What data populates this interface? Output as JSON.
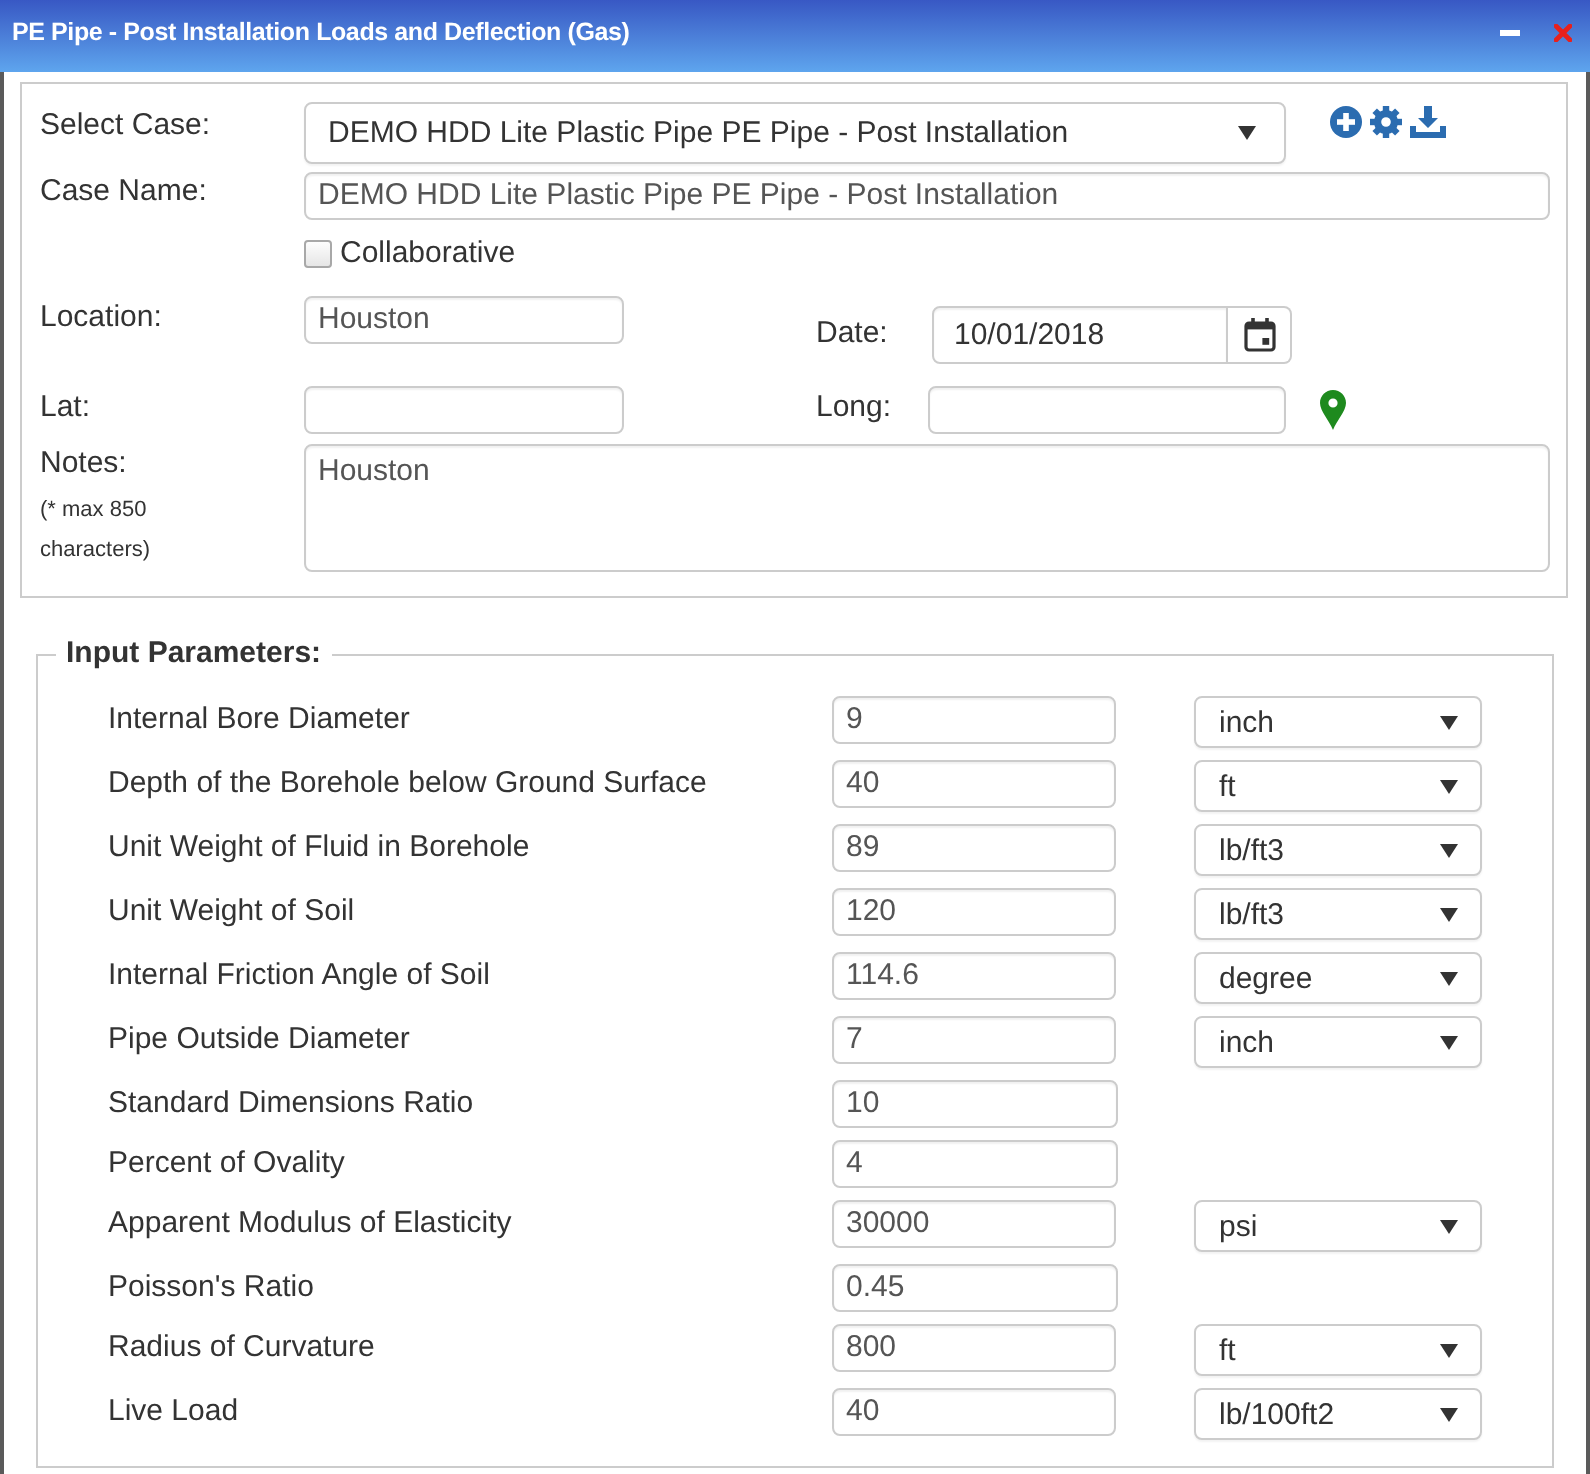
{
  "window": {
    "title": "PE Pipe - Post Installation Loads and Deflection (Gas)"
  },
  "case": {
    "select_case": {
      "label": "Select Case:",
      "value": "DEMO HDD Lite Plastic Pipe PE Pipe - Post Installation"
    },
    "case_name": {
      "label": "Case Name:",
      "value": "DEMO HDD Lite Plastic Pipe PE Pipe - Post Installation"
    },
    "collaborative": {
      "label": "Collaborative",
      "checked": false
    },
    "location": {
      "label": "Location:",
      "value": "Houston"
    },
    "date": {
      "label": "Date:",
      "value": "10/01/2018"
    },
    "lat": {
      "label": "Lat:"
    },
    "long": {
      "label": "Long:"
    },
    "notes": {
      "label": "Notes:",
      "hint": "(* max 850 characters)",
      "value": "Houston"
    }
  },
  "input_parameters": {
    "title": "Input Parameters:",
    "rows": [
      {
        "label": "Internal Bore Diameter",
        "value": "9",
        "unit": "inch"
      },
      {
        "label": "Depth of the Borehole below Ground Surface",
        "value": "40",
        "unit": "ft"
      },
      {
        "label": "Unit Weight of Fluid in Borehole",
        "value": "89",
        "unit": "lb/ft3"
      },
      {
        "label": "Unit Weight of Soil",
        "value": "120",
        "unit": "lb/ft3"
      },
      {
        "label": "Internal Friction Angle of Soil",
        "value": "114.6",
        "unit": "degree"
      },
      {
        "label": "Pipe Outside Diameter",
        "value": "7",
        "unit": "inch"
      },
      {
        "label": "Standard Dimensions Ratio",
        "value": "10"
      },
      {
        "label": "Percent of Ovality",
        "value": "4"
      },
      {
        "label": "Apparent Modulus of Elasticity",
        "value": "30000",
        "unit": "psi"
      },
      {
        "label": "Poisson's Ratio",
        "value": "0.45"
      },
      {
        "label": "Radius of Curvature",
        "value": "800",
        "unit": "ft"
      },
      {
        "label": "Live Load",
        "value": "40",
        "unit": "lb/100ft2"
      }
    ]
  }
}
